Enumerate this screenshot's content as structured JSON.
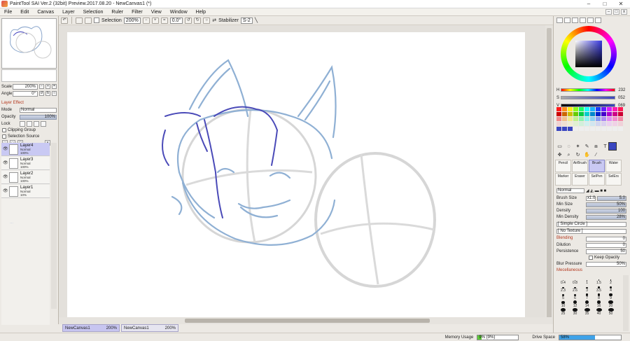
{
  "window": {
    "title": "PaintTool SAI Ver.2 (32bit) Preview.2017.08.20 - NewCanvas1 (*)",
    "minimize": "–",
    "maximize": "□",
    "close": "✕"
  },
  "menu": [
    "File",
    "Edit",
    "Canvas",
    "Layer",
    "Selection",
    "Ruler",
    "Filter",
    "View",
    "Window",
    "Help"
  ],
  "toolbar": {
    "selection_label": "Selection",
    "zoom_value": "200%",
    "angle_value": "0.0°",
    "stabilizer_label": "Stabilizer",
    "stabilizer_value": "S-2"
  },
  "left_panel": {
    "scale_label": "Scale",
    "scale_value": "200%",
    "angle_label": "Angle",
    "angle_value": "0°",
    "layer_effect": "Layer Effect",
    "mode_label": "Mode",
    "mode_value": "Normal",
    "opacity_label": "Opacity",
    "opacity_value": "100%",
    "lock_label": "Lock",
    "clipping_group": "Clipping Group",
    "selection_source": "Selection Source",
    "faint_text": "..."
  },
  "layers": [
    {
      "name": "Layer4",
      "mode": "Normal",
      "opacity": "100%",
      "selected": true
    },
    {
      "name": "Layer3",
      "mode": "Normal",
      "opacity": "100%",
      "selected": false
    },
    {
      "name": "Layer2",
      "mode": "Normal",
      "opacity": "100%",
      "selected": false
    },
    {
      "name": "Layer1",
      "mode": "Normal",
      "opacity": "10%",
      "selected": false
    }
  ],
  "tabs": [
    {
      "name": "NewCanvas1",
      "zoom": "200%",
      "active": true
    },
    {
      "name": "NewCanvas1",
      "zoom": "200%",
      "active": false
    }
  ],
  "status": {
    "memory_label": "Memory Usage",
    "memory_value": "9% (9%)",
    "memory_fraction": 0.09,
    "drive_label": "Drive Space",
    "drive_value": "58%",
    "drive_fraction": 0.58
  },
  "color": {
    "h_label": "H",
    "h_value": "232",
    "s_label": "S",
    "s_value": "052",
    "v_label": "V",
    "v_value": "069",
    "current": "#3a46c0"
  },
  "brushes": [
    {
      "name": "Pencil",
      "selected": false
    },
    {
      "name": "AirBrush",
      "selected": false
    },
    {
      "name": "Brush",
      "selected": true
    },
    {
      "name": "Water",
      "selected": false
    },
    {
      "name": "Marker",
      "selected": false
    },
    {
      "name": "Eraser",
      "selected": false
    },
    {
      "name": "SelPen",
      "selected": false
    },
    {
      "name": "SelErs",
      "selected": false
    }
  ],
  "brush_props": {
    "blend_mode": "Normal",
    "size_label": "Brush Size",
    "size_mult": "x1.0",
    "size_value": "5.0",
    "min_size_label": "Min Size",
    "min_size_value": "50%",
    "density_label": "Density",
    "density_value": "100",
    "min_density_label": "Min Density",
    "min_density_value": "28%",
    "shape_value": "[ Simple Circle ]",
    "texture_value": "[ No Texture ]",
    "blending_label": "Blending",
    "blending_value": "0",
    "dilution_label": "Dilution",
    "dilution_value": "0",
    "persistence_label": "Persistence",
    "persistence_value": "50",
    "keep_opacity_label": "Keep Opacity",
    "blur_pressure_label": "Blur Pressure",
    "blur_pressure_value": "50%",
    "misc_label": "Mecellaneous"
  },
  "brush_sizes": [
    "0.4",
    "0.8",
    "1",
    "1.5",
    "2",
    "2.3",
    "2.6",
    "3",
    "3.5",
    "4",
    "5",
    "6",
    "7",
    "8",
    "9",
    "10",
    "12",
    "14",
    "16",
    "20",
    "25",
    "30",
    "35",
    "40",
    "50"
  ]
}
